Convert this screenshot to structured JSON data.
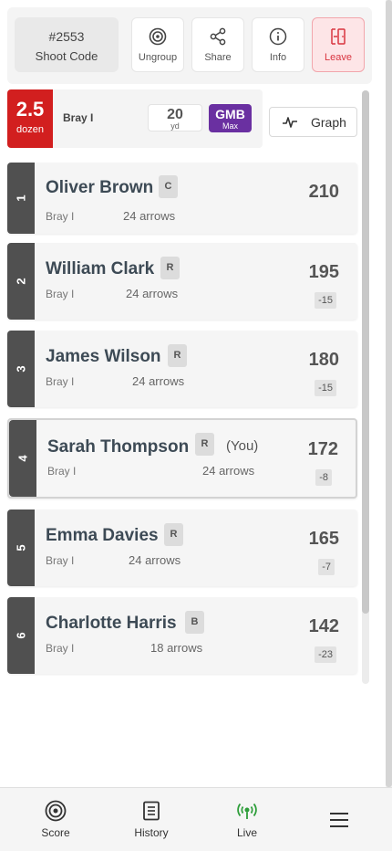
{
  "toolbar": {
    "shoot_code": "#2553",
    "shoot_code_label": "Shoot Code",
    "buttons": [
      {
        "label": "Ungroup",
        "icon": "target-icon"
      },
      {
        "label": "Share",
        "icon": "share-icon"
      },
      {
        "label": "Info",
        "icon": "info-icon"
      },
      {
        "label": "Leave",
        "icon": "leave-icon"
      }
    ]
  },
  "round_info": {
    "dozen_value": "2.5",
    "dozen_unit": "dozen",
    "round_name": "Bray I",
    "distance": "20",
    "distance_unit": "yd",
    "classification": "GMB",
    "classification_sub": "Max",
    "graph_label": "Graph"
  },
  "leaderboard": [
    {
      "rank": "1",
      "name": "Oliver Brown",
      "class": "C",
      "round": "Bray I",
      "arrows": "24 arrows",
      "score": "210",
      "diff": "",
      "you": ""
    },
    {
      "rank": "2",
      "name": "William Clark",
      "class": "R",
      "round": "Bray I",
      "arrows": "24 arrows",
      "score": "195",
      "diff": "-15",
      "you": ""
    },
    {
      "rank": "3",
      "name": "James Wilson",
      "class": "R",
      "round": "Bray I",
      "arrows": "24 arrows",
      "score": "180",
      "diff": "-15",
      "you": ""
    },
    {
      "rank": "4",
      "name": "Sarah Thompson",
      "class": "R",
      "round": "Bray I",
      "arrows": "24 arrows",
      "score": "172",
      "diff": "-8",
      "you": "(You)"
    },
    {
      "rank": "5",
      "name": "Emma Davies",
      "class": "R",
      "round": "Bray I",
      "arrows": "24 arrows",
      "score": "165",
      "diff": "-7",
      "you": ""
    },
    {
      "rank": "6",
      "name": "Charlotte Harris",
      "class": "B",
      "round": "Bray I",
      "arrows": "18 arrows",
      "score": "142",
      "diff": "-23",
      "you": ""
    }
  ],
  "bottom_nav": [
    {
      "label": "Score",
      "icon": "target-icon"
    },
    {
      "label": "History",
      "icon": "clipboard-icon"
    },
    {
      "label": "Live",
      "icon": "live-broadcast-icon"
    },
    {
      "label": "",
      "icon": "menu-icon"
    }
  ],
  "colors": {
    "dozen_badge": "#d21f1f",
    "classification_badge": "#6a30a1",
    "leave_text": "#d9343f",
    "live_icon": "#2e9e3a"
  }
}
